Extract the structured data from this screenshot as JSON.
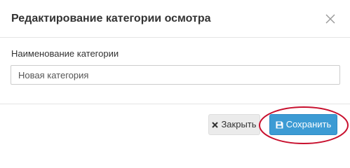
{
  "modal": {
    "title": "Редактирование категории осмотра"
  },
  "form": {
    "category_name_label": "Наименование категории",
    "category_name_value": "Новая категория"
  },
  "footer": {
    "close_label": "Закрыть",
    "save_label": "Сохранить"
  },
  "icons": {
    "header_close": "close-icon",
    "footer_close": "close-icon",
    "save": "floppy-disk-icon"
  },
  "colors": {
    "save_button": "#3c9bd4",
    "close_button": "#ebebeb",
    "annotation": "#c8102e"
  }
}
